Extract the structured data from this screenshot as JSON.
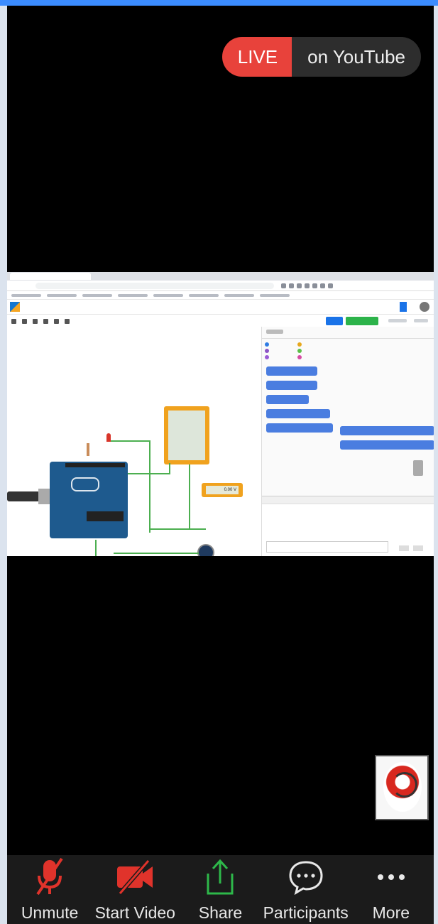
{
  "live_banner": {
    "live_label": "LIVE",
    "platform_label": "on YouTube"
  },
  "shared_screen": {
    "multimeter_reading": "0.00 V"
  },
  "toolbar": {
    "buttons": [
      {
        "label": "Unmute",
        "icon": "muted-microphone-icon"
      },
      {
        "label": "Start Video",
        "icon": "video-off-icon"
      },
      {
        "label": "Share",
        "icon": "share-screen-icon"
      },
      {
        "label": "Participants",
        "icon": "participants-chat-icon"
      },
      {
        "label": "More",
        "icon": "more-dots-icon"
      }
    ]
  },
  "colors": {
    "live_red": "#e8423b",
    "pill_dark": "#2d2d2d",
    "icon_red": "#e0332b",
    "share_green": "#2eb84a",
    "toolbar_bg": "#1b1b1b"
  }
}
